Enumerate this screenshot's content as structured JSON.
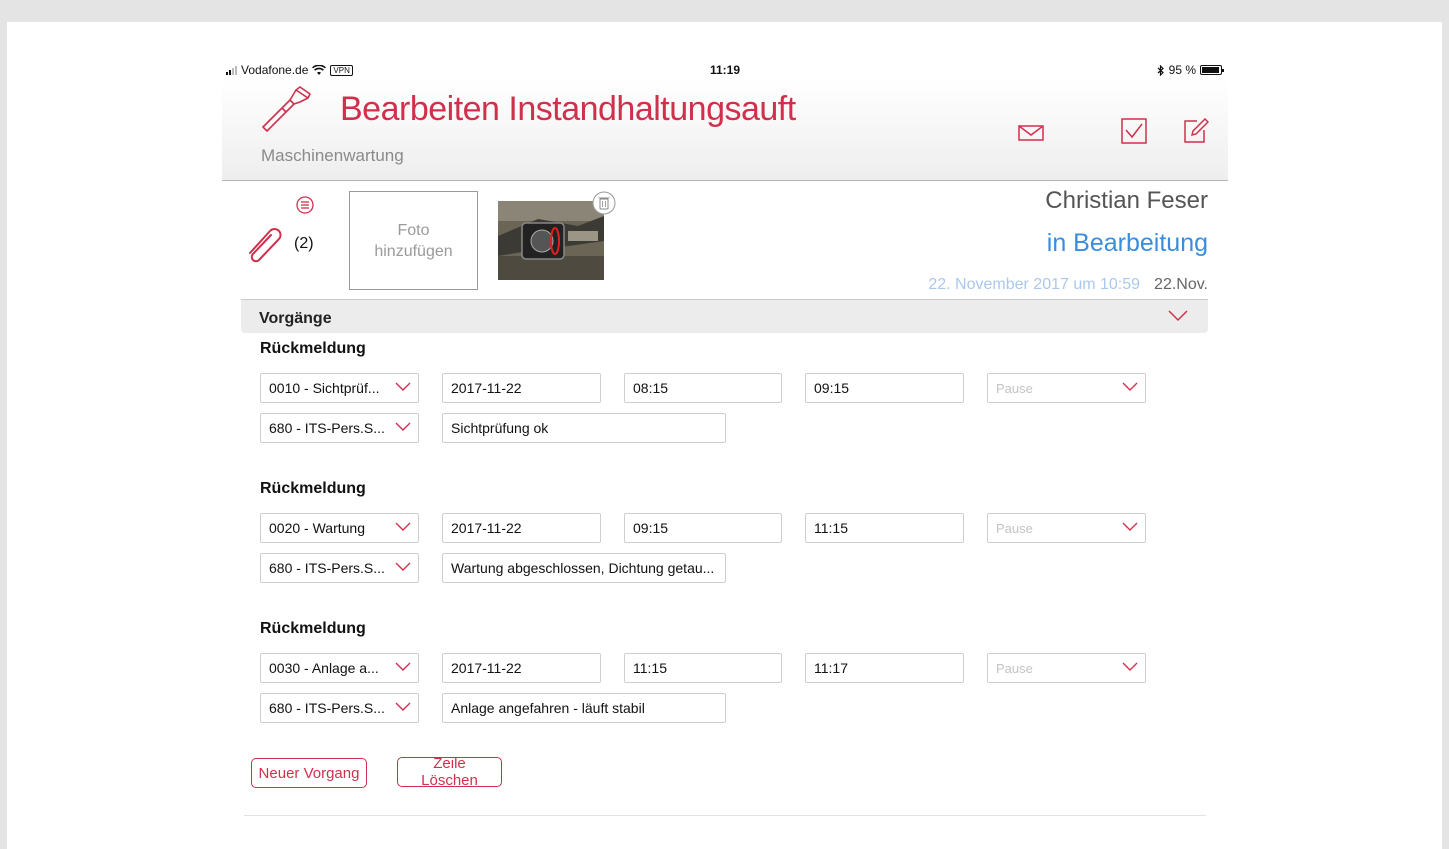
{
  "statusbar": {
    "carrier": "Vodafone.de",
    "vpn": "VPN",
    "time": "11:19",
    "battery": "95 %"
  },
  "header": {
    "title": "Bearbeiten Instandhaltungsauft",
    "subtitle": "Maschinenwartung",
    "icons": [
      "wrench-caliper-icon",
      "mail-icon",
      "checkbox-icon",
      "edit-icon"
    ],
    "accent_color": "#d0304b"
  },
  "meta": {
    "attachments": "(2)",
    "foto_button": "Foto hinzufügen",
    "owner": "Christian Feser",
    "status": "in Bearbeitung",
    "datetime": "22. November 2017 um 10:59",
    "date_short": "22.Nov.",
    "status_color": "#3a8ddc"
  },
  "section": {
    "title": "Vorgänge"
  },
  "entries": [
    {
      "title": "Rückmeldung",
      "operation": "0010 - Sichtprüf...",
      "date": "2017-11-22",
      "start": "08:15",
      "end": "09:15",
      "pause": "Pause",
      "person": "680 - ITS-Pers.S...",
      "note": "Sichtprüfung ok"
    },
    {
      "title": "Rückmeldung",
      "operation": "0020 - Wartung",
      "date": "2017-11-22",
      "start": "09:15",
      "end": "11:15",
      "pause": "Pause",
      "person": "680 - ITS-Pers.S...",
      "note": "Wartung abgeschlossen, Dichtung getau..."
    },
    {
      "title": "Rückmeldung",
      "operation": "0030 - Anlage a...",
      "date": "2017-11-22",
      "start": "11:15",
      "end": "11:17",
      "pause": "Pause",
      "person": "680 - ITS-Pers.S...",
      "note": "Anlage angefahren - läuft stabil"
    }
  ],
  "actions": {
    "new_label": "Neuer Vorgang",
    "delete_label": "Zeile Löschen"
  }
}
